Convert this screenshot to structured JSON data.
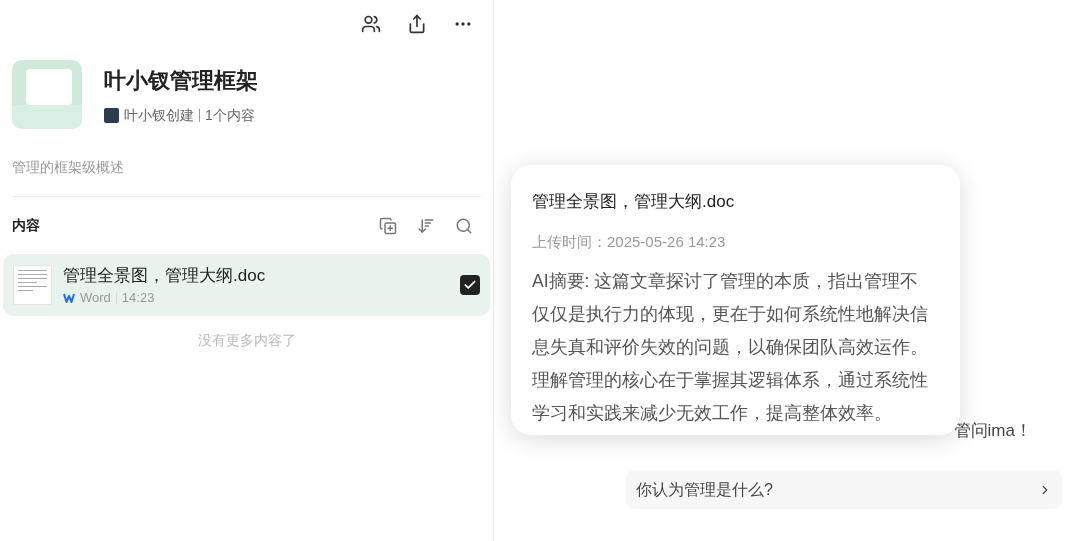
{
  "knowledge_base": {
    "title": "叶小钗管理框架",
    "creator": "叶小钗创建",
    "count": "1个内容",
    "description": "管理的框架级概述"
  },
  "content_section": {
    "heading": "内容"
  },
  "files": [
    {
      "name": "管理全景图，管理大纲.doc",
      "type": "Word",
      "time": "14:23",
      "checked": true,
      "selected": true
    }
  ],
  "end_note": "没有更多内容了",
  "popover": {
    "title": "管理全景图，管理大纲.doc",
    "upload_time": "上传时间：2025-05-26 14:23",
    "summary": "AI摘要: 这篇文章探讨了管理的本质，指出管理不仅仅是执行力的体现，更在于如何系统性地解决信息失真和评价失效的问题，以确保团队高效运作。理解管理的核心在于掌握其逻辑体系，通过系统性学习和实践来减少无效工作，提高整体效率。"
  },
  "chat": {
    "hint": "管问ima！",
    "suggestions": [
      "你认为管理是什么?"
    ]
  }
}
